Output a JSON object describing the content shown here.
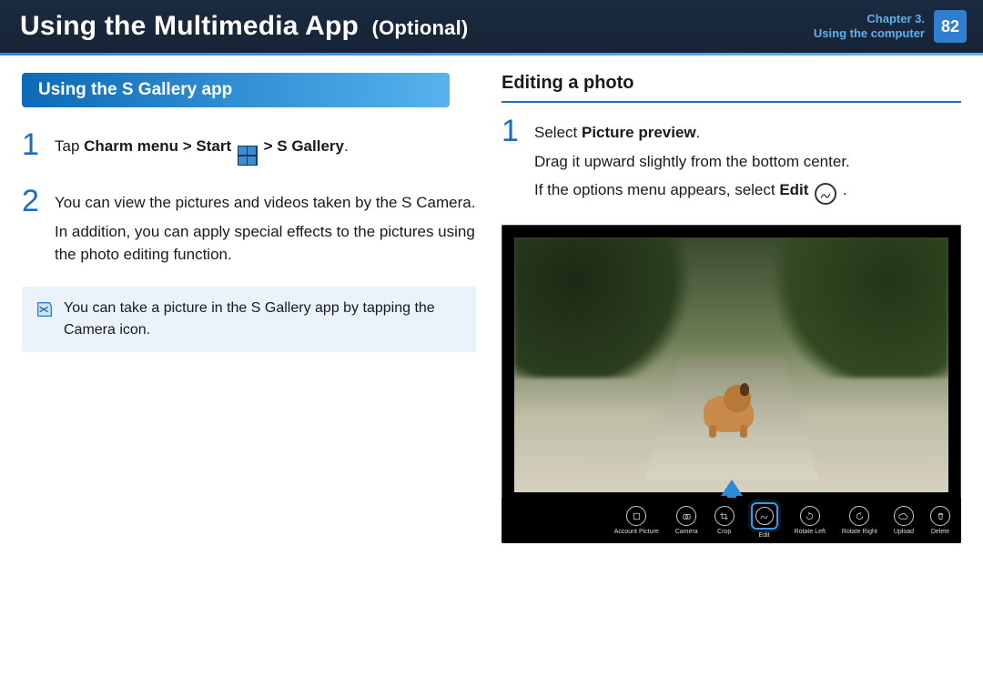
{
  "header": {
    "title_main": "Using the Multimedia App",
    "title_optional": "(Optional)",
    "chapter_line1": "Chapter 3.",
    "chapter_line2": "Using the computer",
    "page_number": "82"
  },
  "left": {
    "section_title": "Using the S Gallery app",
    "step1": {
      "num": "1",
      "pre": "Tap ",
      "bold1": "Charm menu > Start",
      "after_tile": " > ",
      "bold2": "S Gallery",
      "period": "."
    },
    "step2": {
      "num": "2",
      "p1": "You can view the pictures and videos taken by the S Camera.",
      "p2": "In addition, you can apply special effects to the pictures using the photo editing function."
    },
    "note": "You can take a picture in the S Gallery app by tapping the Camera icon."
  },
  "right": {
    "heading": "Editing a photo",
    "step1": {
      "num": "1",
      "l1_pre": "Select ",
      "l1_bold": "Picture preview",
      "l1_post": ".",
      "l2": "Drag it upward slightly from the bottom center.",
      "l3_pre": "If the options menu appears, select ",
      "l3_bold": "Edit",
      "l3_post": " ."
    },
    "toolbar": [
      {
        "id": "account-picture",
        "label": "Account Picture"
      },
      {
        "id": "camera",
        "label": "Camera"
      },
      {
        "id": "crop",
        "label": "Crop"
      },
      {
        "id": "edit",
        "label": "Edit",
        "highlight": true
      },
      {
        "id": "rotate-left",
        "label": "Rotate Left"
      },
      {
        "id": "rotate-right",
        "label": "Rotate Right"
      },
      {
        "id": "upload",
        "label": "Upload"
      },
      {
        "id": "delete",
        "label": "Delete"
      }
    ]
  }
}
